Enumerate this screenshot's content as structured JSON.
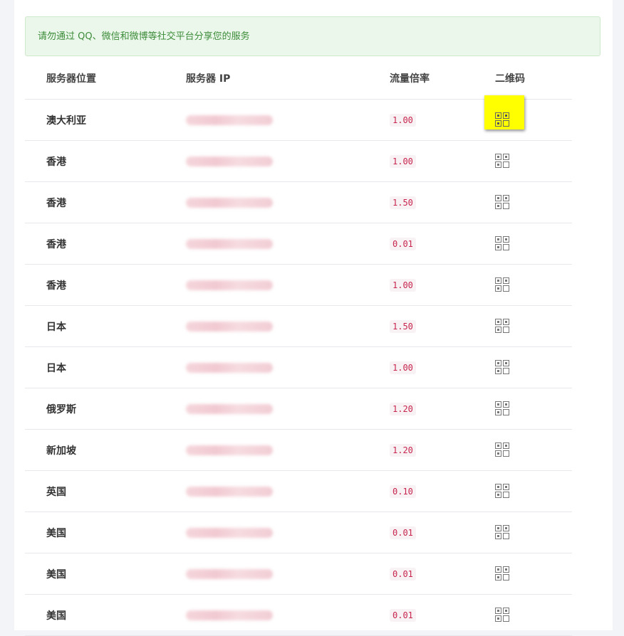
{
  "notice": "请勿通过 QQ、微信和微博等社交平台分享您的服务",
  "columns": {
    "location": "服务器位置",
    "ip": "服务器 IP",
    "rate": "流量倍率",
    "qr": "二维码"
  },
  "rows": [
    {
      "location": "澳大利亚",
      "rate": "1.00",
      "qr_active": true
    },
    {
      "location": "香港",
      "rate": "1.00"
    },
    {
      "location": "香港",
      "rate": "1.50"
    },
    {
      "location": "香港",
      "rate": "0.01"
    },
    {
      "location": "香港",
      "rate": "1.00"
    },
    {
      "location": "日本",
      "rate": "1.50"
    },
    {
      "location": "日本",
      "rate": "1.00"
    },
    {
      "location": "俄罗斯",
      "rate": "1.20"
    },
    {
      "location": "新加坡",
      "rate": "1.20"
    },
    {
      "location": "英国",
      "rate": "0.10"
    },
    {
      "location": "美国",
      "rate": "0.01"
    },
    {
      "location": "美国",
      "rate": "0.01"
    },
    {
      "location": "美国",
      "rate": "0.01"
    }
  ],
  "icons": {
    "qr": "qrcode-icon"
  },
  "colors": {
    "notice_bg": "#ebf7ea",
    "notice_text": "#3c8c3a",
    "rate_text": "#c7254e",
    "highlight": "#ffff00"
  }
}
